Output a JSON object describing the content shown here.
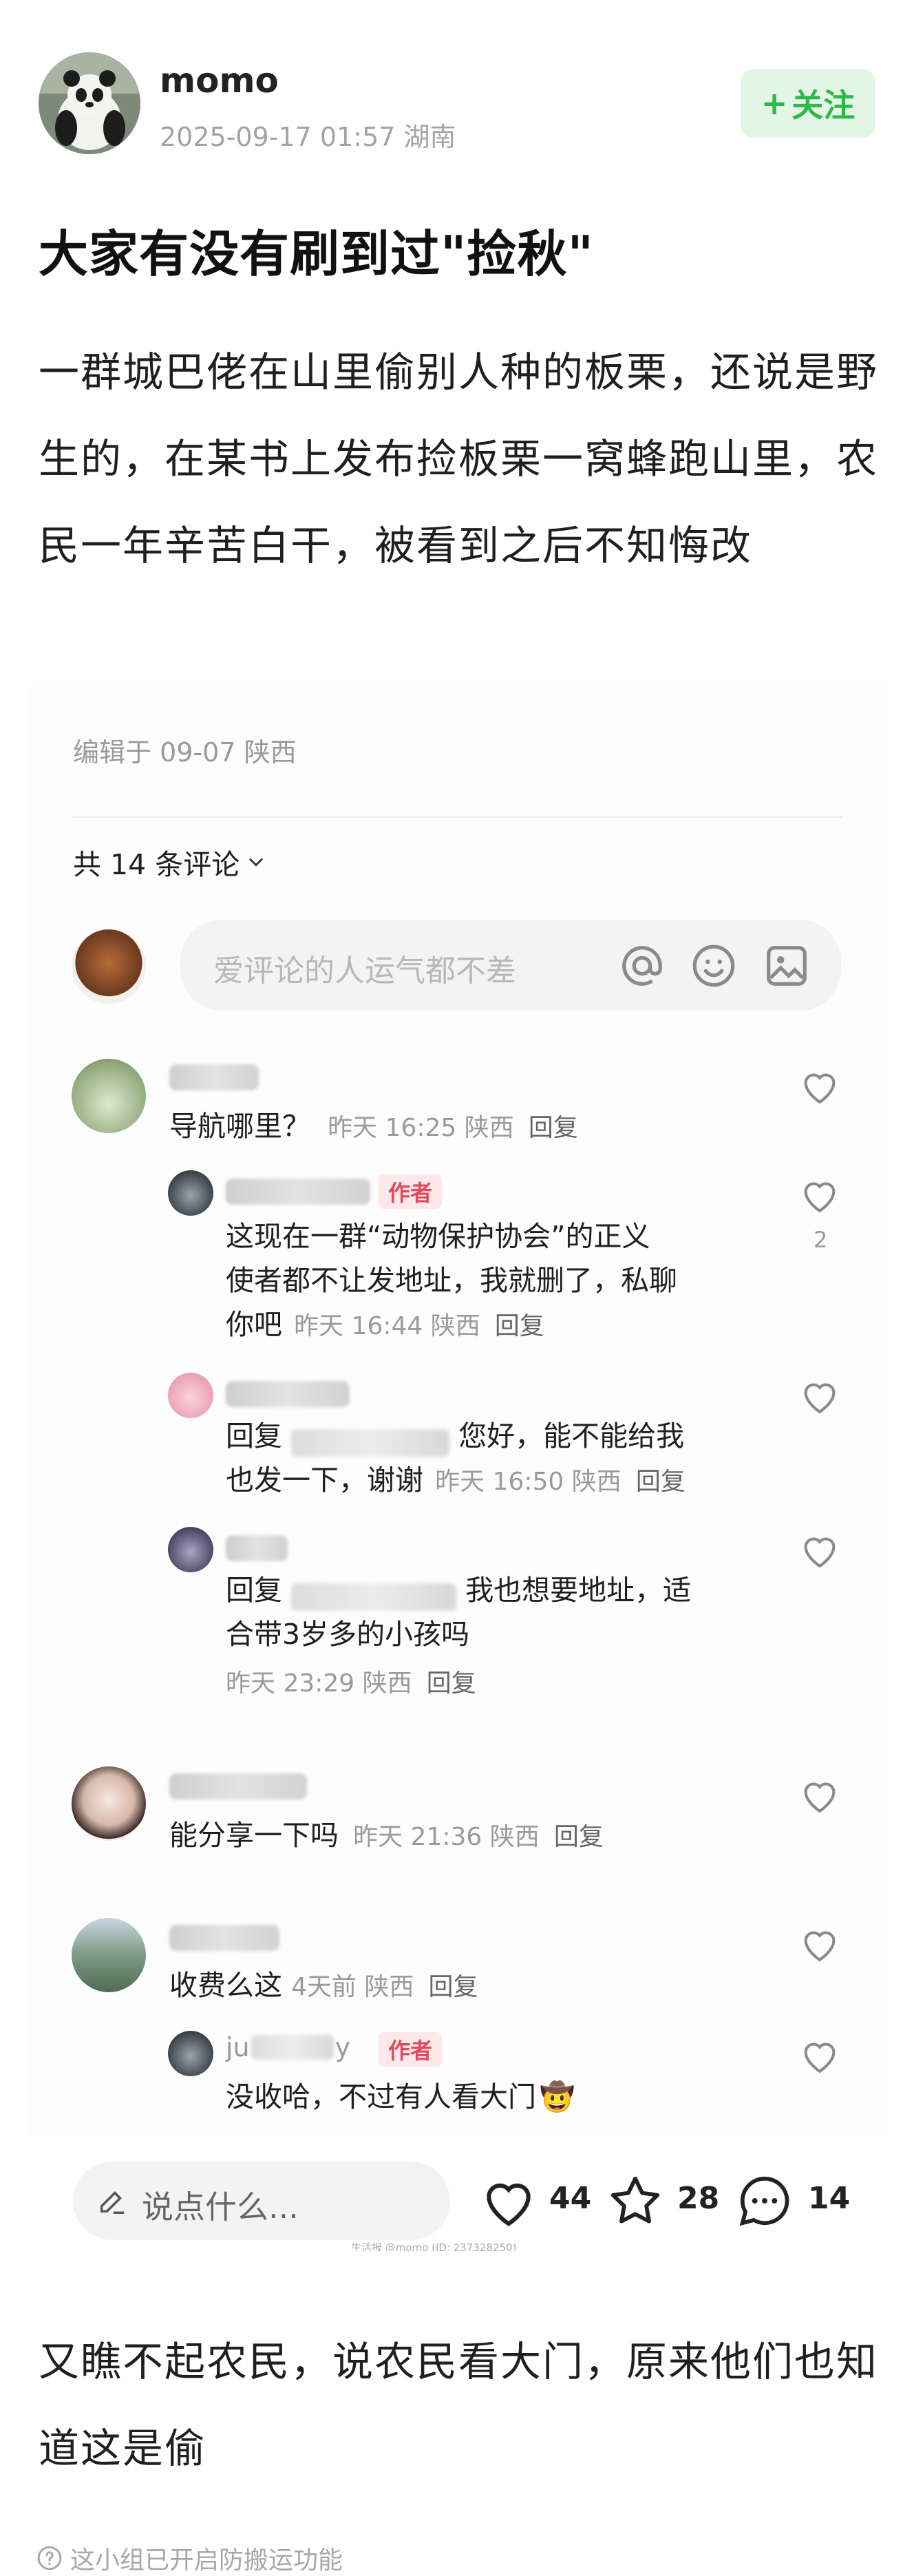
{
  "post": {
    "author": "momo",
    "meta": "2025-09-17 01:57  湖南",
    "follow_label": "关注",
    "follow_plus": "+",
    "title": "大家有没有刷到过\"捡秋\"",
    "body": "一群城巴佬在山里偷别人种的板栗，还说是野生的，在某书上发布捡板栗一窝蜂跑山里，农民一年辛苦白干，被看到之后不知悔改"
  },
  "screenshot": {
    "edited": "编辑于 09-07 陕西",
    "comment_count": "共 14 条评论",
    "input_placeholder": "爱评论的人运气都不差",
    "comments": [
      {
        "text": "导航哪里？",
        "time": "昨天 16:25 陕西",
        "reply": "回复"
      },
      {
        "text": "能分享一下吗",
        "time": "昨天 21:36 陕西",
        "reply": "回复"
      },
      {
        "text": "收费么这",
        "time": "4天前  陕西",
        "reply": "回复"
      }
    ],
    "replies": [
      {
        "tag": "作者",
        "text1": "这现在一群“动物保护协会”的正义",
        "text2": "使者都不让发地址，我就删了，私聊",
        "text3": "你吧",
        "time": "昨天 16:44 陕西",
        "reply": "回复",
        "likes": "2"
      },
      {
        "prefix": "回复",
        "text1": "您好，能不能给我",
        "text2": "也发一下，谢谢",
        "time": "昨天 16:50 陕西",
        "reply": "回复"
      },
      {
        "prefix": "回复",
        "text1": "我也想要地址，适",
        "text2": "合带3岁多的小孩吗",
        "time": "昨天 23:29 陕西",
        "reply": "回复"
      },
      {
        "name_partial": "ju",
        "name_tail": "y",
        "tag": "作者",
        "text": "没收哈，不过有人看大门",
        "emoji": "🤠"
      }
    ],
    "bottom_bar": {
      "placeholder": "说点什么...",
      "likes": "44",
      "stars": "28",
      "comments": "14"
    },
    "watermark": "生活报 @momo (ID: 237328250)"
  },
  "footer": {
    "text": "又瞧不起农民，说农民看大门，原来他们也知道这是偷",
    "notice": "这小组已开启防搬运功能"
  },
  "colors": {
    "accent_green": "#2fb84c",
    "author_tag": "#e24a5c"
  }
}
